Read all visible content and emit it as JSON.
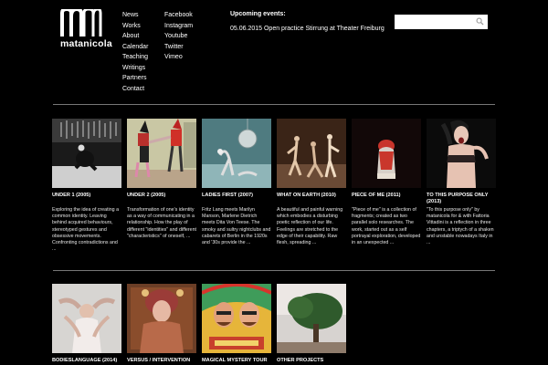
{
  "site": {
    "logo_text": "matanicola"
  },
  "nav": {
    "main": [
      "News",
      "Works",
      "About",
      "Calendar",
      "Teaching",
      "Writings",
      "Partners",
      "Contact"
    ],
    "social": [
      "Facebook",
      "Instagram",
      "Youtube",
      "Twitter",
      "Vimeo"
    ]
  },
  "events": {
    "title": "Upcoming events:",
    "items": [
      "05.06.2015 Open practice Stirrung at Theater Freiburg"
    ]
  },
  "search": {
    "placeholder": "",
    "icon": "search-icon"
  },
  "works_row1": [
    {
      "title": "UNDER 1 (2005)",
      "desc": "Exploring the idea of creating a common identity. Leaving behind acquired behaviours, stereotyped gestures and obsessive movements. Confronting contradictions and ..."
    },
    {
      "title": "UNDER 2 (2005)",
      "desc": "Transformation of one's identity as a way of communicating in a relationship. How the play of different \"identities\" and different \"characteristics\" of oneself, ..."
    },
    {
      "title": "LADIES FIRST (2007)",
      "desc": "Fritz Lang meets Marilyn Manson, Marlene Dietrich meets Dita Von Teese. The smoky and sultry nightclubs and cabarets of Berlin in the 1920s and '30s provide the ..."
    },
    {
      "title": "WHAT ON EARTH (2010)",
      "desc": "A beautiful and painful warning which embodies a disturbing poetic reflection of our life. Feelings are stretched to the edge of their capability. Raw flesh, spreading ..."
    },
    {
      "title": "PIECE OF ME (2011)",
      "desc": "\"Piece of me\" is a collection of fragments; created as two parallel solo researches. The work, started out as a self portrayal exploration, developed in an unexpected ..."
    },
    {
      "title": "TO THIS PURPOSE ONLY (2013)",
      "desc": "\"To this purpose only\" by matanicola for & with Fattoria Vittadini is a reflection in three chapters, a triptych of a shaken and unstable nowadays Italy in ..."
    }
  ],
  "works_row2": [
    {
      "title": "BODIESLANGUAGE (2014)"
    },
    {
      "title": "VERSUS / INTERVENTION"
    },
    {
      "title": "MAGICAL MYSTERY TOUR"
    },
    {
      "title": "OTHER PROJECTS"
    }
  ],
  "colors": {
    "background": "#000000",
    "text": "#ffffff",
    "divider": "#777777"
  }
}
